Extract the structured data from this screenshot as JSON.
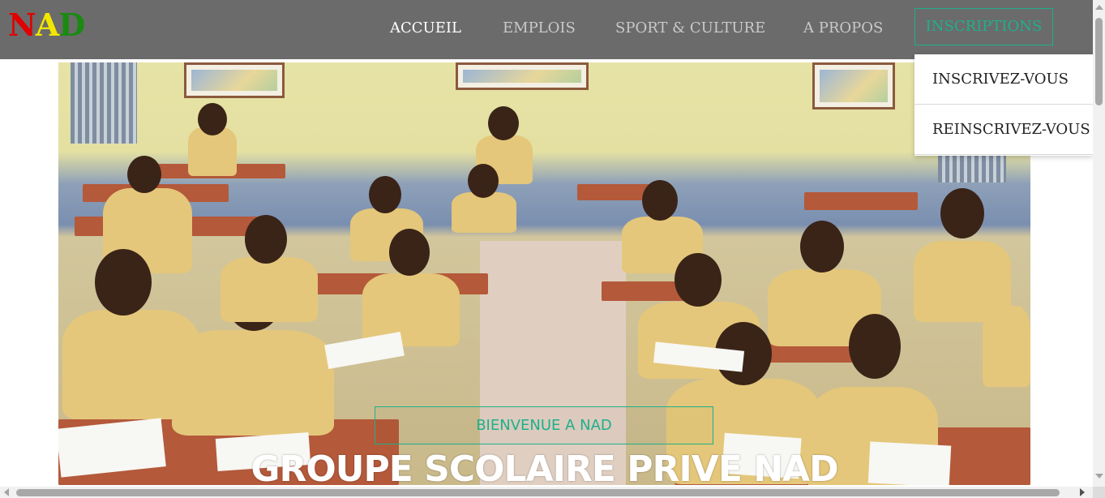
{
  "brand": {
    "letters": [
      {
        "char": "N",
        "color": "#e00000"
      },
      {
        "char": "A",
        "color": "#f2e600"
      },
      {
        "char": "D",
        "color": "#1a8a12"
      }
    ]
  },
  "nav": {
    "items": [
      {
        "label": "ACCUEIL",
        "active": true
      },
      {
        "label": "EMPLOIS",
        "active": false
      },
      {
        "label": "SPORT & CULTURE",
        "active": false
      },
      {
        "label": "A PROPOS",
        "active": false
      }
    ],
    "inscriptions_label": "INSCRIPTIONS",
    "accent_color": "#1fb08a"
  },
  "dropdown": {
    "items": [
      {
        "label": "INSCRIVEZ-VOUS"
      },
      {
        "label": "REINSCRIVEZ-VOUS"
      }
    ]
  },
  "hero": {
    "image_description_icon": "classroom-photo",
    "welcome_label": "BIENVENUE A NAD",
    "title": "GROUPE SCOLAIRE PRIVE NAD"
  }
}
